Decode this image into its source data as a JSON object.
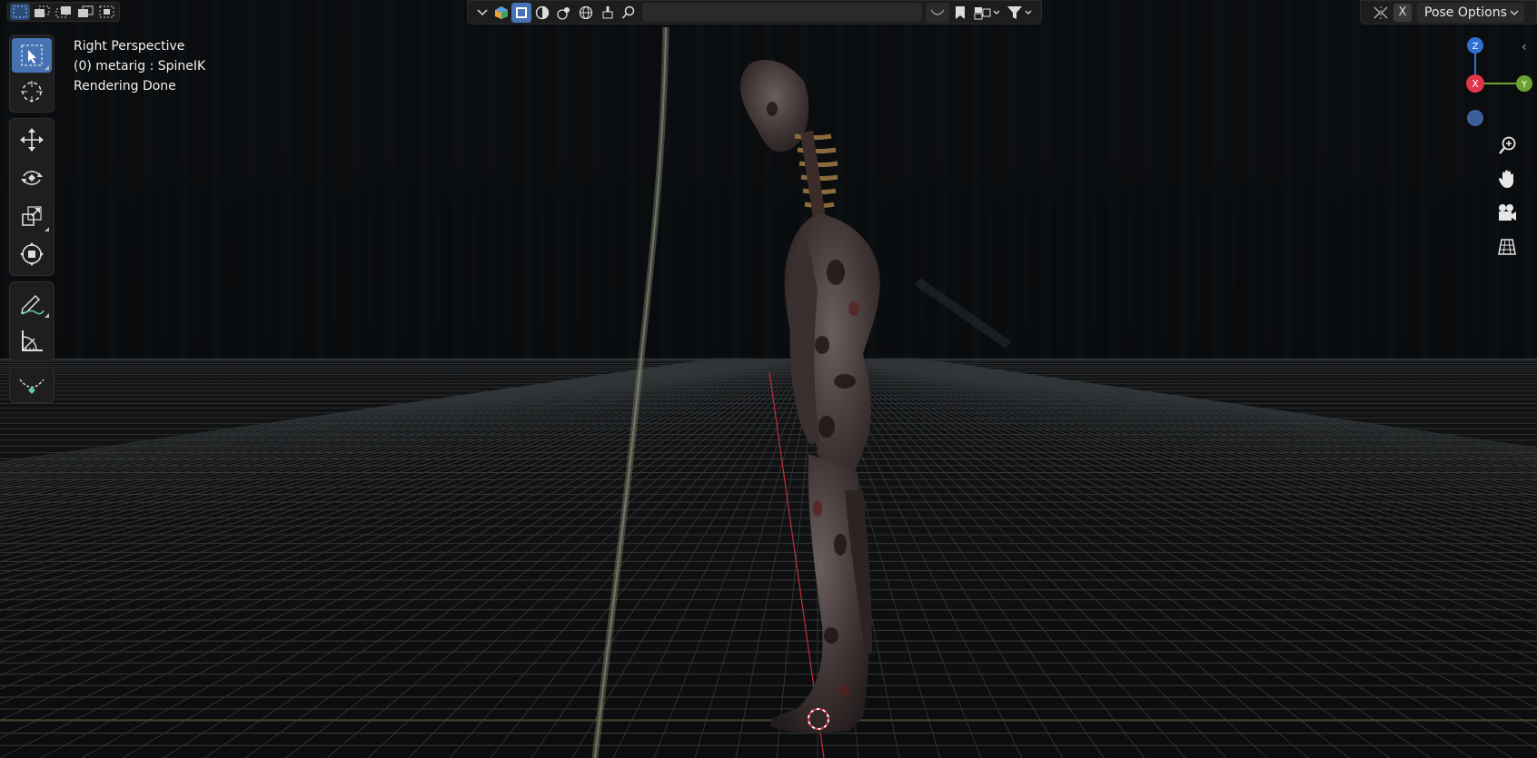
{
  "viewport": {
    "view_name": "Right Perspective",
    "object_label": "(0) metarig : SpineIK",
    "status": "Rendering Done"
  },
  "header": {
    "search": {
      "value": "",
      "placeholder": ""
    },
    "x_label": "X",
    "pose_options_label": "Pose Options",
    "chevron": "⌄"
  },
  "gizmo": {
    "z_label": "Z",
    "x_label": "X",
    "y_label": "Y",
    "colors": {
      "z": "#2f6fd0",
      "x": "#e0354b",
      "y": "#6aa331",
      "neg_y": "#5f7d2b",
      "neg_z": "#3c5f9a"
    }
  },
  "toolbar": {
    "tools": [
      "select-box",
      "cursor",
      "move",
      "rotate",
      "scale",
      "transform",
      "annotate",
      "measure",
      "bone-envelope"
    ]
  },
  "right_nav": [
    "zoom-icon",
    "pan-hand-icon",
    "camera-view-icon",
    "ortho-grid-icon"
  ],
  "colors": {
    "accent": "#4772b3",
    "panel": "#1d1d1d",
    "floor_grid": "#4a4a4a"
  }
}
